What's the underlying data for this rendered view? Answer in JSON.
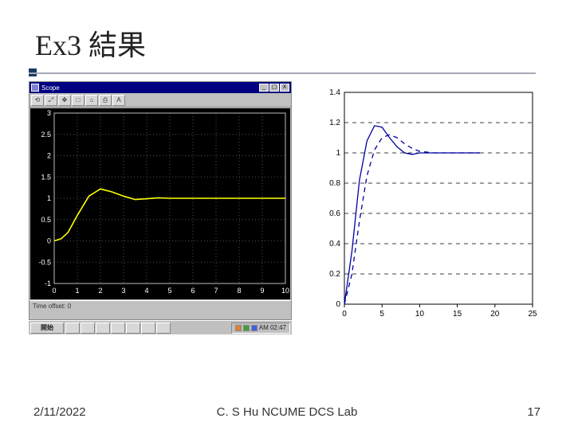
{
  "title": "Ex3 結果",
  "footer": {
    "date": "2/11/2022",
    "credit": "C. S Hu   NCUME DCS Lab",
    "page": "17"
  },
  "scope": {
    "window_title": "Scope",
    "window_buttons": [
      "_",
      "▢",
      "X"
    ],
    "toolbar_icons": [
      "⟲",
      "⤢",
      "✥",
      "□",
      "⌂",
      "⎙",
      "A"
    ],
    "status_text": "Time offset: 0",
    "taskbar": {
      "start_label": "開始",
      "tray_time": "AM 02:47"
    }
  },
  "chart_data": [
    {
      "name": "scope_trace",
      "type": "line",
      "title": "",
      "xlabel": "",
      "ylabel": "",
      "xlim": [
        0,
        10
      ],
      "ylim": [
        -1,
        3
      ],
      "xticks": [
        0,
        1,
        2,
        3,
        4,
        5,
        6,
        7,
        8,
        9,
        10
      ],
      "yticks": [
        -1,
        -0.5,
        0,
        0.5,
        1,
        1.5,
        2,
        2.5,
        3
      ],
      "series": [
        {
          "name": "response",
          "color": "#ffff00",
          "x": [
            0,
            0.3,
            0.6,
            1.0,
            1.5,
            2.0,
            2.5,
            3.0,
            3.5,
            4.0,
            4.5,
            5.0,
            6.0,
            7.0,
            8.0,
            9.0,
            10.0
          ],
          "y": [
            0,
            0.05,
            0.2,
            0.6,
            1.05,
            1.22,
            1.15,
            1.05,
            0.97,
            0.99,
            1.01,
            1.0,
            1.0,
            1.0,
            1.0,
            1.0,
            1.0
          ]
        }
      ]
    },
    {
      "name": "matlab_figure",
      "type": "line",
      "title": "",
      "xlabel": "",
      "ylabel": "",
      "xlim": [
        0,
        25
      ],
      "ylim": [
        0,
        1.4
      ],
      "xticks": [
        0,
        5,
        10,
        15,
        20,
        25
      ],
      "yticks": [
        0,
        0.2,
        0.4,
        0.6,
        0.8,
        1.0,
        1.2,
        1.4
      ],
      "series": [
        {
          "name": "step-solid",
          "color": "#0000a0",
          "style": "solid",
          "x": [
            0,
            1,
            2,
            3,
            4,
            5,
            6,
            7,
            8,
            9,
            10,
            12,
            14,
            16,
            18
          ],
          "y": [
            0,
            0.35,
            0.82,
            1.08,
            1.18,
            1.17,
            1.1,
            1.04,
            1.0,
            0.99,
            1.0,
            1.0,
            1.0,
            1.0,
            1.0
          ]
        },
        {
          "name": "step-dashed",
          "color": "#0000a0",
          "style": "dashed",
          "x": [
            0,
            1,
            2,
            3,
            4,
            5,
            6,
            7,
            8,
            9,
            10,
            12,
            14,
            16,
            18
          ],
          "y": [
            0,
            0.2,
            0.55,
            0.85,
            1.02,
            1.1,
            1.12,
            1.1,
            1.06,
            1.03,
            1.01,
            1.0,
            1.0,
            1.0,
            1.0
          ]
        }
      ]
    }
  ]
}
